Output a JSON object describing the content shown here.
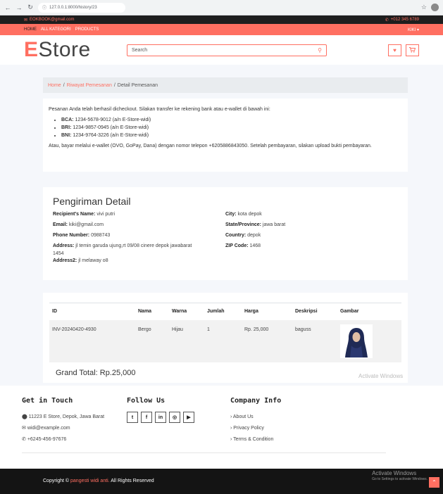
{
  "browser": {
    "url": "127.0.0.1:8000/history/23"
  },
  "topbar": {
    "email": "EOKBOOK@gmail.com",
    "phone": "+012 345 6789"
  },
  "menubar": {
    "items": [
      "HOME",
      "ALL KATEGORI",
      "PRODUCTS"
    ],
    "user": "KIKI ▾"
  },
  "header": {
    "logo_first": "E",
    "logo_rest": "Store",
    "search_placeholder": "Search"
  },
  "breadcrumb": {
    "home": "Home",
    "history": "Riwayat Pemesanan",
    "current": "Detail Pemesanan"
  },
  "payment": {
    "intro": "Pesanan Anda telah berhasil dicheckout. Silakan transfer ke rekening bank atau e-wallet di bawah ini:",
    "banks": [
      {
        "bank": "BCA:",
        "detail": "1234-5678-9012 (a/n E-Store-widi)"
      },
      {
        "bank": "BRI:",
        "detail": "1234-9857-0945 (a/n E-Store-widi)"
      },
      {
        "bank": "BNI:",
        "detail": "1234-9764-3226 (a/n E-Store-widi)"
      }
    ],
    "outro": "Atau, bayar melalui e-wallet (OVO, GoPay, Dana) dengan nomor telepon +6205886843050. Setelah pembayaran, silakan upload bukti pembayaran."
  },
  "shipping": {
    "title": "Pengiriman Detail",
    "left": [
      {
        "label": "Recipient's Name:",
        "value": "vivi putri"
      },
      {
        "label": "Email:",
        "value": "kiki@gmail.com"
      },
      {
        "label": "Phone Number:",
        "value": "0988743"
      },
      {
        "label": "Address:",
        "value": "jl temin garuda ujung,rt 09/08 cinere depok jawabarat"
      }
    ],
    "address_cont": "1454",
    "address2_label": "Address2:",
    "address2_value": "jl melaway o8",
    "right": [
      {
        "label": "City:",
        "value": "kota depok"
      },
      {
        "label": "State/Province:",
        "value": "jawa barat"
      },
      {
        "label": "Country:",
        "value": "depok"
      },
      {
        "label": "ZIP Code:",
        "value": "1468"
      }
    ]
  },
  "order": {
    "headers": [
      "ID",
      "Nama",
      "Warna",
      "Jumlah",
      "Harga",
      "Deskripsi",
      "Gambar"
    ],
    "row": [
      "INV-20240420-4930",
      "Bergo",
      "Hijau",
      "1",
      "Rp. 25,000",
      "baguss"
    ],
    "grand_total": "Grand Total: Rp.25,000"
  },
  "watermark": "Activate Windows",
  "footer": {
    "touch_title": "Get in Touch",
    "address": "11223 E Store, Depok, Jawa Barat",
    "email": "widi@example.com",
    "phone": "+6245-456-97676",
    "follow_title": "Follow Us",
    "company_title": "Company Info",
    "company_links": [
      "About Us",
      "Privacy Policy",
      "Terms & Condition"
    ]
  },
  "bottom": {
    "copy_prefix": "Copyright ©",
    "copy_name": "pangesti widi anti.",
    "copy_suffix": "All Rights Reserved",
    "win_title": "Activate Windows",
    "win_sub": "Go to Settings to activate Windows."
  },
  "colors": {
    "accent": "#ff6f61",
    "dark": "#1e1e1e"
  }
}
